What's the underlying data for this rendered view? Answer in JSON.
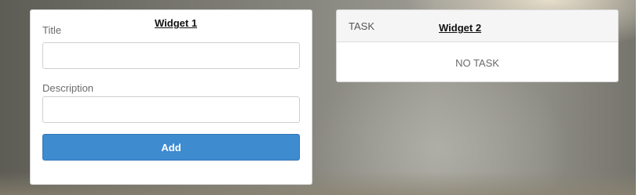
{
  "widget1": {
    "title": "Widget 1",
    "title_field": {
      "label": "Title",
      "value": "",
      "placeholder": ""
    },
    "description_field": {
      "label": "Description",
      "value": "",
      "placeholder": ""
    },
    "add_label": "Add",
    "button_color": "#3e8bd0"
  },
  "widget2": {
    "column_header": "TASK",
    "title": "Widget 2",
    "empty_message": "NO TASK"
  }
}
